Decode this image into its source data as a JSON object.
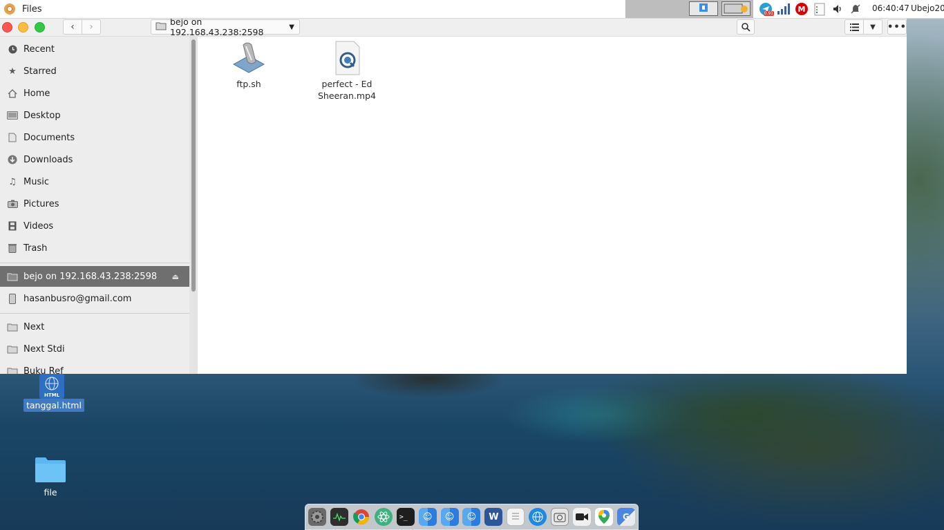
{
  "top_panel": {
    "app_name": "Files",
    "clock": "06:40:47",
    "user": "Ubejo20",
    "tray_badge": "0.91",
    "tray_icons": [
      "telegram-icon",
      "network-signal-icon",
      "mega-icon",
      "clipboard-icon",
      "volume-icon",
      "notifications-muted-icon"
    ]
  },
  "window": {
    "path_label": "bejo on 192.168.43.238:2598",
    "nav": {
      "back_glyph": "‹",
      "forward_glyph": "›"
    }
  },
  "sidebar": {
    "places": [
      {
        "label": "Recent",
        "icon": "clock-icon"
      },
      {
        "label": "Starred",
        "icon": "star-icon"
      },
      {
        "label": "Home",
        "icon": "home-icon"
      },
      {
        "label": "Desktop",
        "icon": "desktop-icon"
      },
      {
        "label": "Documents",
        "icon": "document-icon"
      },
      {
        "label": "Downloads",
        "icon": "download-icon"
      },
      {
        "label": "Music",
        "icon": "music-icon"
      },
      {
        "label": "Pictures",
        "icon": "camera-icon"
      },
      {
        "label": "Videos",
        "icon": "film-icon"
      },
      {
        "label": "Trash",
        "icon": "trash-icon"
      }
    ],
    "network": [
      {
        "label": "bejo on 192.168.43.238:2598",
        "icon": "network-folder-icon",
        "selected": true
      },
      {
        "label": "hasanbusro@gmail.com",
        "icon": "drive-icon",
        "selected": false
      }
    ],
    "bookmarks": [
      {
        "label": "Next",
        "icon": "folder-icon"
      },
      {
        "label": "Next Stdi",
        "icon": "folder-icon"
      },
      {
        "label": "Buku Ref",
        "icon": "folder-icon"
      }
    ]
  },
  "files": [
    {
      "name": "ftp.sh",
      "icon": "script-icon"
    },
    {
      "name": "perfect - Ed Sheeran.mp4",
      "icon": "video-file-icon"
    }
  ],
  "desktop": [
    {
      "name": "tanggal.html",
      "icon": "html-file-icon",
      "badge": "HTML",
      "selected": true
    },
    {
      "name": "file",
      "icon": "folder-icon",
      "selected": false
    }
  ],
  "dock": [
    "system-settings-icon",
    "system-monitor-icon",
    "chrome-icon",
    "atom-icon",
    "terminal-icon",
    "finder-icon",
    "finder-icon",
    "finder-icon",
    "word-icon",
    "text-editor-icon",
    "browser-icon",
    "screenshot-icon",
    "video-camera-icon",
    "maps-icon",
    "translate-icon"
  ]
}
